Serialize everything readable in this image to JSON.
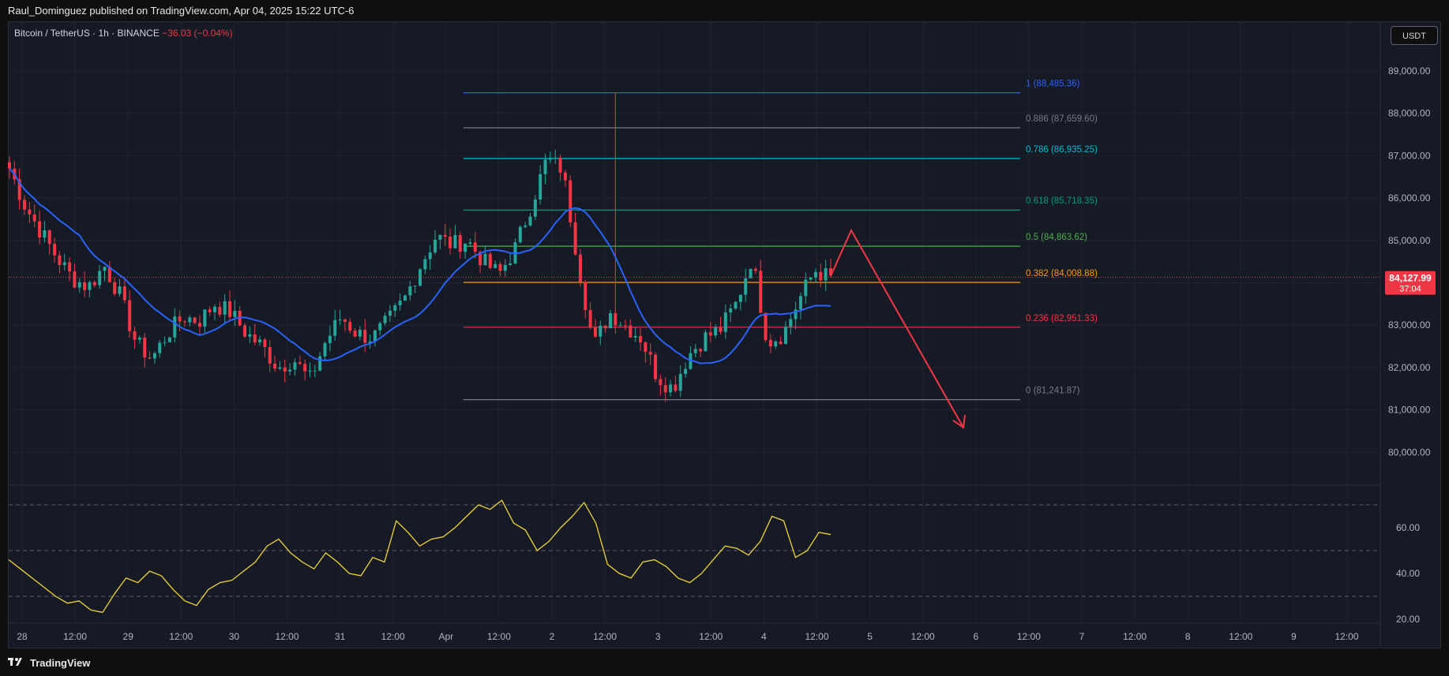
{
  "header": {
    "text": "Raul_Dominguez published on TradingView.com, Apr 04, 2025 15:22 UTC-6"
  },
  "symbol": {
    "name": "Bitcoin / TetherUS · 1h · BINANCE",
    "change": "−36.03 (−0.04%)"
  },
  "currency_button": "USDT",
  "price_tag": {
    "price": "84,127.99",
    "countdown": "37:04",
    "color": "#f23645"
  },
  "footer": {
    "logo_text": "TradingView"
  },
  "colors": {
    "background": "#161a25",
    "bull": "#26a69a",
    "bear": "#f23645",
    "ma": "#2962ff",
    "rsi": "#f0d43a",
    "arrow": "#f23645"
  },
  "icons": {
    "logo": "tradingview-logo-icon"
  },
  "chart_data": {
    "type": "candlestick",
    "title": "Bitcoin / TetherUS · 1h · BINANCE",
    "y_axis": {
      "ylim": [
        79000,
        89500
      ],
      "ticks": [
        "89,000.00",
        "88,000.00",
        "87,000.00",
        "86,000.00",
        "85,000.00",
        "84,000.00",
        "83,000.00",
        "82,000.00",
        "81,000.00",
        "80,000.00"
      ]
    },
    "x_axis": {
      "ticks": [
        "28",
        "12:00",
        "29",
        "12:00",
        "30",
        "12:00",
        "31",
        "12:00",
        "Apr",
        "12:00",
        "2",
        "12:00",
        "3",
        "12:00",
        "4",
        "12:00",
        "5",
        "12:00",
        "6",
        "12:00",
        "7",
        "12:00",
        "8",
        "12:00",
        "9",
        "12:00"
      ]
    },
    "price_series_approx": [
      86700,
      85800,
      85200,
      84600,
      84100,
      83900,
      84400,
      83700,
      82600,
      82200,
      82800,
      83200,
      83100,
      83500,
      83300,
      82800,
      82500,
      82000,
      82200,
      81700,
      82600,
      83200,
      82800,
      82700,
      83100,
      83600,
      84400,
      85100,
      84900,
      85000,
      84500,
      84200,
      84800,
      85800,
      86900,
      86700,
      84500,
      82500,
      83300,
      83000,
      82700,
      81800,
      81500,
      82300,
      82700,
      82900,
      83500,
      84600,
      82600,
      82800,
      83600,
      84300,
      84100
    ],
    "fibonacci": [
      {
        "level": "1",
        "value": "88,485.36",
        "color": "#2962ff"
      },
      {
        "level": "0.886",
        "value": "87,659.60",
        "color": "#787b86"
      },
      {
        "level": "0.786",
        "value": "86,935.25",
        "color": "#00bcd4"
      },
      {
        "level": "0.618",
        "value": "85,718.35",
        "color": "#089981"
      },
      {
        "level": "0.5",
        "value": "84,863.62",
        "color": "#4caf50"
      },
      {
        "level": "0.382",
        "value": "84,008.88",
        "color": "#ff9800"
      },
      {
        "level": "0.236",
        "value": "82,951.33",
        "color": "#f23645"
      },
      {
        "level": "0",
        "value": "81,241.87",
        "color": "#787b86"
      }
    ],
    "rsi": {
      "ticks": [
        "60.00",
        "40.00",
        "20.00"
      ],
      "ylim": [
        15,
        80
      ],
      "bands": [
        70,
        50,
        30
      ],
      "values": [
        46,
        42,
        38,
        34,
        30,
        27,
        28,
        24,
        23,
        31,
        38,
        36,
        41,
        39,
        33,
        28,
        26,
        33,
        36,
        37,
        41,
        45,
        52,
        55,
        49,
        45,
        42,
        49,
        45,
        40,
        39,
        47,
        45,
        63,
        58,
        52,
        55,
        56,
        60,
        65,
        70,
        68,
        72,
        62,
        59,
        50,
        54,
        60,
        65,
        71,
        62,
        44,
        40,
        38,
        45,
        46,
        43,
        38,
        36,
        40,
        46,
        52,
        51,
        48,
        54,
        65,
        63,
        47,
        50,
        58,
        57
      ]
    },
    "grid": true
  }
}
